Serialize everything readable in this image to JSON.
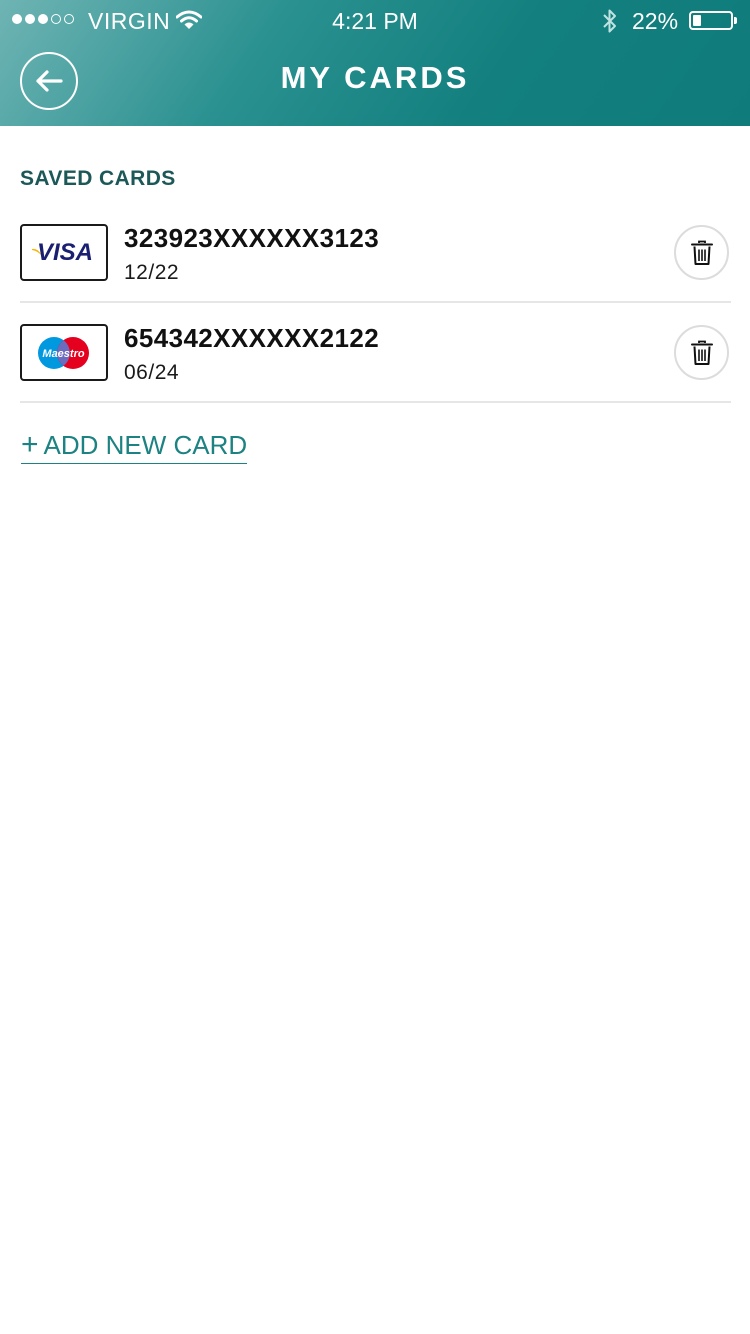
{
  "status_bar": {
    "carrier": "VIRGIN",
    "time": "4:21 PM",
    "battery_percent_label": "22%",
    "battery_level": 0.22,
    "signal_bars": 3,
    "signal_total": 5
  },
  "header": {
    "title": "MY CARDS"
  },
  "saved_cards": {
    "section_title": "SAVED CARDS",
    "cards": [
      {
        "brand": "VISA",
        "number": "323923XXXXXX3123",
        "expiry": "12/22"
      },
      {
        "brand": "Maestro",
        "number": "654342XXXXXX2122",
        "expiry": "06/24"
      }
    ]
  },
  "add_card": {
    "plus": "+",
    "label": "ADD NEW CARD"
  },
  "colors": {
    "header_teal": "#13807f",
    "accent": "#1c8282",
    "section_title": "#1d5858",
    "visa_navy": "#1a1f71",
    "visa_gold": "#f7b600",
    "maestro_blue": "#0099df",
    "maestro_red": "#e6001f"
  },
  "icons": {
    "back": "arrow-left-icon",
    "delete": "trash-icon",
    "wifi": "wifi-icon",
    "bluetooth": "bluetooth-icon"
  }
}
